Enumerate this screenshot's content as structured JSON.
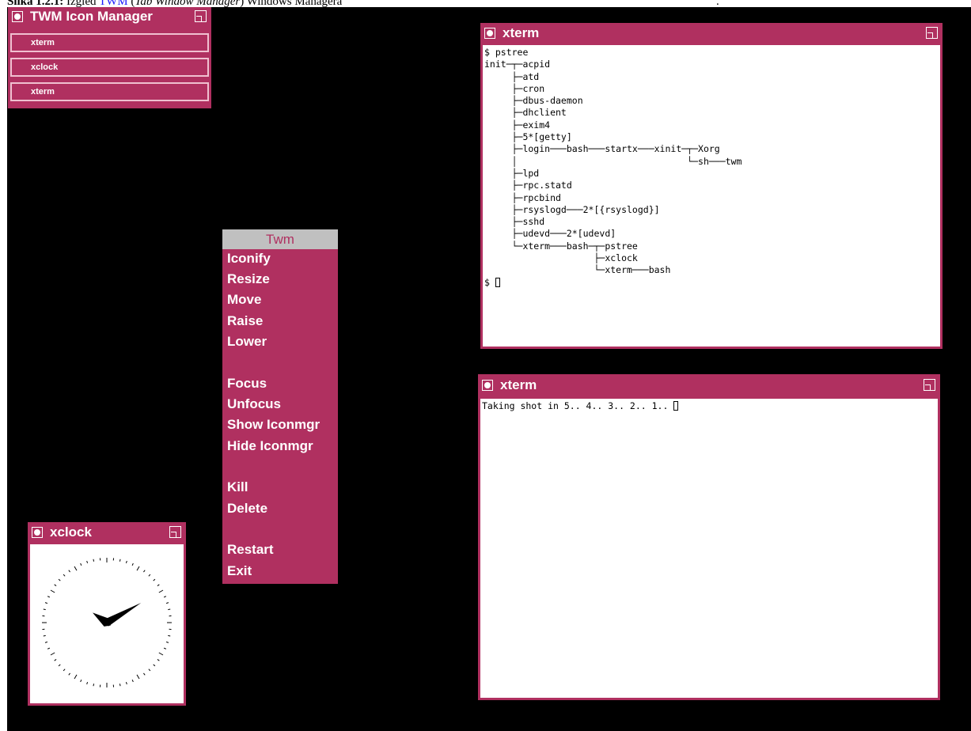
{
  "caption": {
    "prefix": "Slika 1.2.1:",
    "text_before_link": "Izgled",
    "link": "TWM",
    "text_after_link": "(",
    "italic": "Tab Window Manager",
    "text_end": ") Windows Managera",
    "trailing": "."
  },
  "icon_manager": {
    "title": "TWM Icon Manager",
    "items": [
      "xterm",
      "xclock",
      "xterm"
    ]
  },
  "xterm_top": {
    "title": "xterm",
    "lines": [
      "$ pstree",
      "init─┬─acpid",
      "     ├─atd",
      "     ├─cron",
      "     ├─dbus-daemon",
      "     ├─dhclient",
      "     ├─exim4",
      "     ├─5*[getty]",
      "     ├─login───bash───startx───xinit─┬─Xorg",
      "     │                               └─sh───twm",
      "     ├─lpd",
      "     ├─rpc.statd",
      "     ├─rpcbind",
      "     ├─rsyslogd───2*[{rsyslogd}]",
      "     ├─sshd",
      "     ├─udevd───2*[udevd]",
      "     └─xterm───bash─┬─pstree",
      "                    ├─xclock",
      "                    └─xterm───bash"
    ],
    "prompt": "$ "
  },
  "xterm_bottom": {
    "title": "xterm",
    "line": "Taking shot in 5.. 4.. 3.. 2.. 1.. "
  },
  "twm_menu": {
    "title": "Twm",
    "items": [
      "Iconify",
      "Resize",
      "Move",
      "Raise",
      "Lower",
      "Focus",
      "Unfocus",
      "Show Iconmgr",
      "Hide Iconmgr",
      "Kill",
      "Delete",
      "Restart",
      "Exit"
    ]
  },
  "xclock": {
    "title": "xclock",
    "hour": 10,
    "minute": 10
  },
  "colors": {
    "titlebar": "#b03060",
    "desktop": "#000000",
    "menu_title_bg": "#c0c0c0"
  }
}
